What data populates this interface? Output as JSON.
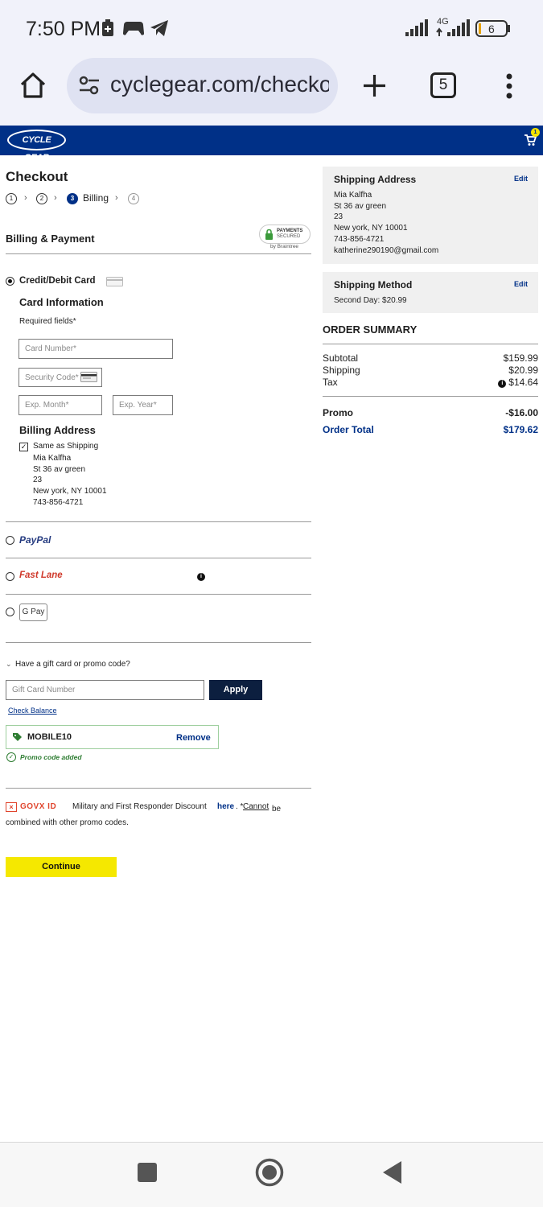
{
  "status_bar": {
    "time": "7:50 PM",
    "network": "4G",
    "battery": "6"
  },
  "browser": {
    "url": "cyclegear.com/checkout",
    "tab_count": "5"
  },
  "site": {
    "logo": "CYCLE GEAR",
    "cart_count": "1"
  },
  "checkout": {
    "title": "Checkout",
    "steps": [
      "1",
      "2",
      "3",
      "4"
    ],
    "active_step_label": "Billing"
  },
  "billing": {
    "section_title": "Billing & Payment",
    "secure_badge": {
      "line1": "PAYMENTS",
      "line2": "SECURED",
      "line3": "by Braintree"
    },
    "card_option_label": "Credit/Debit Card",
    "card_info_title": "Card Information",
    "required_note": "Required fields*",
    "card_number_placeholder": "Card Number*",
    "security_code_placeholder": "Security Code*",
    "exp_month_placeholder": "Exp. Month*",
    "exp_year_placeholder": "Exp. Year*",
    "billing_address_title": "Billing Address",
    "same_as_shipping_label": "Same as Shipping",
    "address_lines": [
      "Mia Kalfha",
      "St 36 av green",
      "23",
      "New york, NY 10001",
      "743-856-4721"
    ]
  },
  "payment_options": {
    "paypal": "PayPal",
    "fastlane": "Fast Lane",
    "gpay": "G Pay"
  },
  "promo": {
    "toggle_label": "Have a gift card or promo code?",
    "gift_card_placeholder": "Gift Card Number",
    "apply_label": "Apply",
    "check_balance_label": "Check Balance",
    "applied_code": "MOBILE10",
    "remove_label": "Remove",
    "added_message": "Promo code added"
  },
  "govx": {
    "logo": "GOVX ID",
    "text_before": "Military and First Responder Discount",
    "link_here": "here",
    "text_mid": ". *",
    "link_cannot": "Cannot",
    "text_after": " be combined with other promo codes."
  },
  "continue_label": "Continue",
  "shipping_address": {
    "title": "Shipping Address",
    "edit_label": "Edit",
    "lines": [
      "Mia Kalfha",
      "St 36 av green",
      "23",
      "New york, NY 10001",
      "743-856-4721",
      "katherine290190@gmail.com"
    ]
  },
  "shipping_method": {
    "title": "Shipping Method",
    "edit_label": "Edit",
    "value": "Second Day: $20.99"
  },
  "order_summary": {
    "title": "ORDER SUMMARY",
    "subtotal_label": "Subtotal",
    "subtotal": "$159.99",
    "shipping_label": "Shipping",
    "shipping": "$20.99",
    "tax_label": "Tax",
    "tax": "$14.64",
    "promo_label": "Promo",
    "promo": "-$16.00",
    "total_label": "Order Total",
    "total": "$179.62"
  },
  "colors": {
    "brand_blue": "#003087",
    "continue_yellow": "#f5e800",
    "fastlane_red": "#d03a2c",
    "promo_green": "#2e7d32",
    "govx_red": "#e0452d"
  }
}
